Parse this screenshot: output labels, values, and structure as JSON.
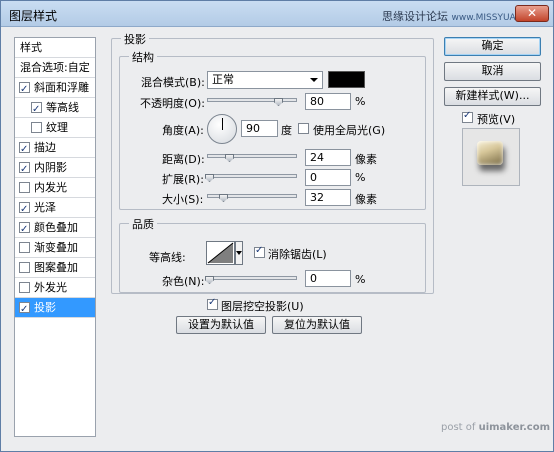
{
  "window": {
    "title": "图层样式"
  },
  "watermark_top": {
    "text": "思缘设计论坛",
    "url": "www.MISSYUAN.com"
  },
  "close_label": "✕",
  "list": {
    "header": "样式",
    "blend_options": "混合选项:自定",
    "items": [
      {
        "label": "斜面和浮雕",
        "checked": true,
        "indent": false
      },
      {
        "label": "等高线",
        "checked": true,
        "indent": true
      },
      {
        "label": "纹理",
        "checked": false,
        "indent": true
      },
      {
        "label": "描边",
        "checked": true,
        "indent": false
      },
      {
        "label": "内阴影",
        "checked": true,
        "indent": false
      },
      {
        "label": "内发光",
        "checked": false,
        "indent": false
      },
      {
        "label": "光泽",
        "checked": true,
        "indent": false
      },
      {
        "label": "颜色叠加",
        "checked": true,
        "indent": false
      },
      {
        "label": "渐变叠加",
        "checked": false,
        "indent": false
      },
      {
        "label": "图案叠加",
        "checked": false,
        "indent": false
      },
      {
        "label": "外发光",
        "checked": false,
        "indent": false
      },
      {
        "label": "投影",
        "checked": true,
        "indent": false,
        "selected": true
      }
    ]
  },
  "shadow": {
    "section_title": "投影",
    "structure_title": "结构",
    "blend_mode_label": "混合模式(B):",
    "blend_mode_value": "正常",
    "shadow_color": "#000000",
    "opacity_label": "不透明度(O):",
    "opacity_value": "80",
    "opacity_unit": "%",
    "opacity_fraction": 0.8,
    "angle_label": "角度(A):",
    "angle_value": "90",
    "angle_unit": "度",
    "global_light_label": "使用全局光(G)",
    "global_light_checked": false,
    "distance_label": "距离(D):",
    "distance_value": "24",
    "distance_unit": "像素",
    "spread_label": "扩展(R):",
    "spread_value": "0",
    "spread_unit": "%",
    "size_label": "大小(S):",
    "size_value": "32",
    "size_unit": "像素"
  },
  "quality": {
    "title": "品质",
    "contour_label": "等高线:",
    "antialias_label": "消除锯齿(L)",
    "antialias_checked": true,
    "noise_label": "杂色(N):",
    "noise_value": "0",
    "noise_unit": "%"
  },
  "knockout": {
    "label": "图层挖空投影(U)",
    "checked": true
  },
  "buttons": {
    "make_default": "设置为默认值",
    "reset_default": "复位为默认值",
    "ok": "确定",
    "cancel": "取消",
    "new_style": "新建样式(W)...",
    "preview_label": "预览(V)",
    "preview_checked": true
  },
  "watermark_bottom": {
    "prefix": "post of ",
    "site": "uimaker.com"
  },
  "colors": {
    "selection": "#3399ff",
    "titlebar": "#c9ddf2"
  }
}
